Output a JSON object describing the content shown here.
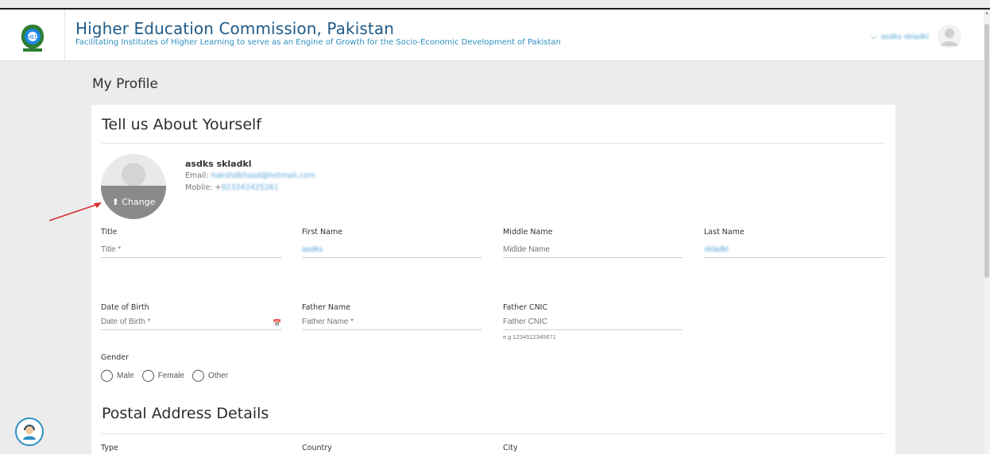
{
  "header": {
    "title": "Higher Education Commission, Pakistan",
    "subtitle": "Facilitating Institutes of Higher Learning to serve as an Engine of Growth for the Socio-Economic Development of Pakistan",
    "user_name": "asdks skladkl"
  },
  "page": {
    "title": "My Profile"
  },
  "about": {
    "section_title": "Tell us About Yourself",
    "profile": {
      "name": "asdks skladkl",
      "email_label": "Email:",
      "email_value": "hakshdkhasd@hotmail.com",
      "mobile_label": "Mobile: +",
      "mobile_value": "923242425261",
      "change_label": "Change"
    },
    "fields": {
      "title_label": "Title",
      "title_placeholder": "Title *",
      "first_name_label": "First Name",
      "first_name_value": "asdks",
      "middle_name_label": "Middle Name",
      "middle_name_placeholder": "Midlde Name",
      "last_name_label": "Last Name",
      "last_name_value": "skladkl",
      "dob_label": "Date of Birth",
      "dob_placeholder": "Date of Birth *",
      "father_name_label": "Father Name",
      "father_name_placeholder": "Father Name *",
      "father_cnic_label": "Father CNIC",
      "father_cnic_placeholder": "Father CNIC",
      "father_cnic_hint": "e.g 1234512345671",
      "gender_label": "Gender",
      "gender_options": [
        "Male",
        "Female",
        "Other"
      ]
    }
  },
  "postal": {
    "section_title": "Postal Address Details",
    "type_label": "Type",
    "country_label": "Country",
    "city_label": "City"
  },
  "icons": {
    "logo": "hec-logo-icon",
    "chevron": "chevron-down-icon",
    "avatar": "user-avatar-icon",
    "upload": "upload-icon",
    "calendar": "calendar-icon",
    "help": "support-agent-icon"
  },
  "colors": {
    "brand_title": "#1f5a86",
    "brand_sub": "#2e8fc2",
    "annotation_arrow": "#d32f2f"
  }
}
